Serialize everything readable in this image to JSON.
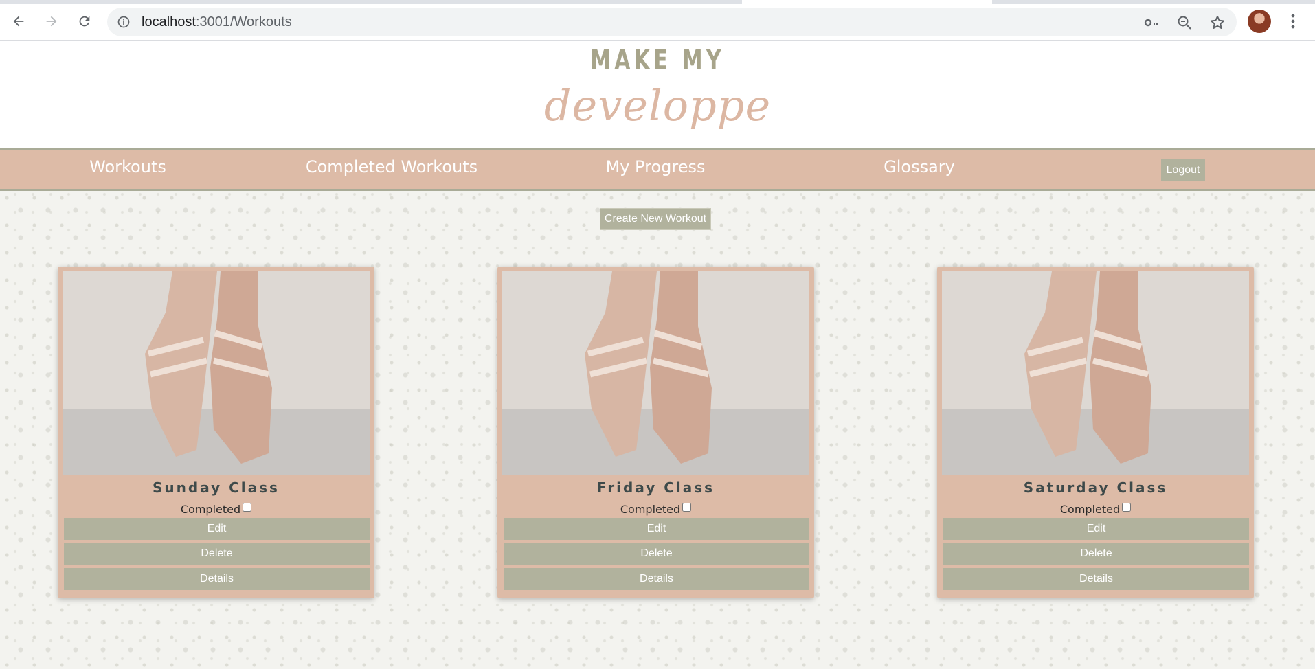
{
  "browser": {
    "url_host": "localhost",
    "url_path": ":3001/Workouts"
  },
  "logo": {
    "top_text": "MAKE MY",
    "script_text": "developpe"
  },
  "nav": {
    "links": [
      "Workouts",
      "Completed Workouts",
      "My Progress",
      "Glossary"
    ],
    "logout_label": "Logout"
  },
  "actions": {
    "create_label": "Create New Workout"
  },
  "workouts": [
    {
      "title": "Sunday Class",
      "completed_label": "Completed",
      "completed": false,
      "edit_label": "Edit",
      "delete_label": "Delete",
      "details_label": "Details"
    },
    {
      "title": "Friday Class",
      "completed_label": "Completed",
      "completed": false,
      "edit_label": "Edit",
      "delete_label": "Delete",
      "details_label": "Details"
    },
    {
      "title": "Saturday Class",
      "completed_label": "Completed",
      "completed": false,
      "edit_label": "Edit",
      "delete_label": "Delete",
      "details_label": "Details"
    }
  ],
  "colors": {
    "brand_peach": "#ddbba7",
    "brand_sage": "#b1b29d",
    "logo_sage": "#a7a48a",
    "logo_peach": "#dcb7a3"
  }
}
